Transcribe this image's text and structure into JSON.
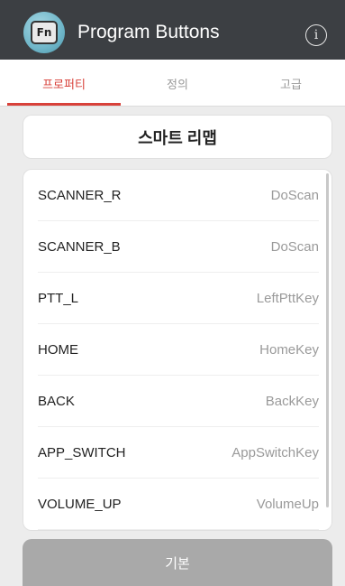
{
  "header": {
    "icon_label": "Fn",
    "title": "Program Buttons",
    "info_symbol": "i"
  },
  "tabs": [
    {
      "label": "프로퍼티",
      "active": true
    },
    {
      "label": "정의",
      "active": false
    },
    {
      "label": "고급",
      "active": false
    }
  ],
  "preset": {
    "label": "스마트 리맵"
  },
  "mappings": [
    {
      "key": "SCANNER_R",
      "value": "DoScan"
    },
    {
      "key": "SCANNER_B",
      "value": "DoScan"
    },
    {
      "key": "PTT_L",
      "value": "LeftPttKey"
    },
    {
      "key": "HOME",
      "value": "HomeKey"
    },
    {
      "key": "BACK",
      "value": "BackKey"
    },
    {
      "key": "APP_SWITCH",
      "value": "AppSwitchKey"
    },
    {
      "key": "VOLUME_UP",
      "value": "VolumeUp"
    }
  ],
  "footer": {
    "default_label": "기본"
  },
  "colors": {
    "header_bg": "#3c3f43",
    "accent": "#d8413a",
    "disabled_button": "#a9a9a9"
  }
}
